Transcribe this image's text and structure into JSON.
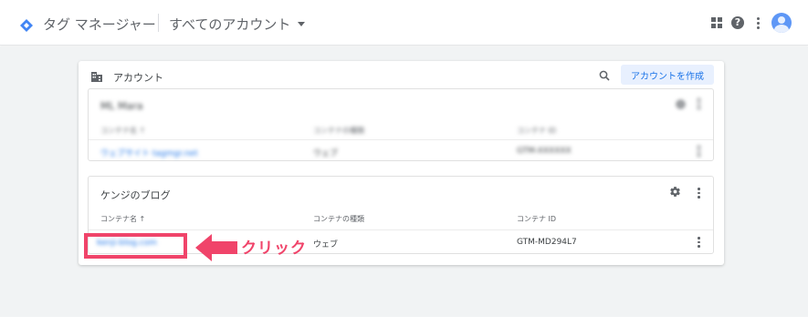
{
  "header": {
    "app_title": "タグ マネージャー",
    "account_switch_label": "すべてのアカウント"
  },
  "card": {
    "title": "アカウント",
    "create_button": "アカウントを作成"
  },
  "accounts": [
    {
      "name": "ML Mara",
      "columns": [
        "コンテナ名 ↑",
        "コンテナの種類",
        "コンテナ ID"
      ],
      "row": {
        "container_name": "ウェブサイト tagmgr.net",
        "type": "ウェブ",
        "id": "GTM-XXXXXX"
      }
    },
    {
      "name": "ケンジのブログ",
      "columns": [
        "コンテナ名 ↑",
        "コンテナの種類",
        "コンテナ ID"
      ],
      "row": {
        "container_name": "kenji-blog.com",
        "type": "ウェブ",
        "id": "GTM-MD294L7"
      }
    }
  ],
  "annotation": {
    "label": "クリック",
    "color": "#f0446a"
  },
  "colors": {
    "accent": "#1a73e8",
    "logo": "#4285f4"
  }
}
